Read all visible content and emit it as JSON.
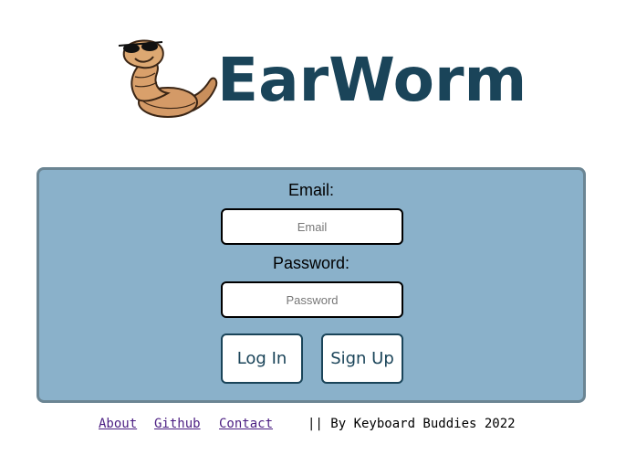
{
  "brand": {
    "name": "EarWorm",
    "logo_icon": "worm-with-sunglasses-icon",
    "color": "#1a4459"
  },
  "login_form": {
    "panel_color": "#8ab1ca",
    "email_label": "Email:",
    "email_placeholder": "Email",
    "email_value": "",
    "password_label": "Password:",
    "password_placeholder": "Password",
    "password_value": "",
    "login_label": "Log In",
    "signup_label": "Sign Up"
  },
  "footer": {
    "links": [
      "About",
      "Github",
      "Contact"
    ],
    "credit": "|| By Keyboard Buddies 2022"
  }
}
